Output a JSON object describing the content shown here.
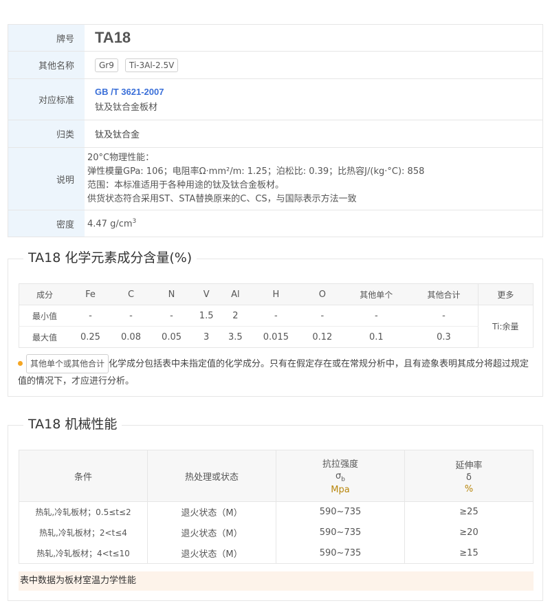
{
  "info": {
    "grade_label": "牌号",
    "grade": "TA18",
    "alias_label": "其他名称",
    "aliases": [
      "Gr9",
      "Ti-3Al-2.5V"
    ],
    "standard_label": "对应标准",
    "standard_code": "GB /T 3621-2007",
    "standard_name": "钛及钛合金板材",
    "category_label": "归类",
    "category": "钛及钛合金",
    "desc_label": "说明",
    "desc_lines": [
      "20°C物理性能：",
      "弹性模量GPa: 106；电阻率Ω·mm²/m: 1.25；泊松比: 0.39；比热容J/(kg·°C): 858",
      "范围：本标准适用于各种用途的钛及钛合金板材。",
      "供货状态符合采用ST、STA替换原来的C、CS，与国际表示方法一致"
    ],
    "density_label": "密度",
    "density": "4.47 g/cm",
    "density_exp": "3"
  },
  "chem": {
    "title": "TA18 化学元素成分含量(%)",
    "headers": [
      "成分",
      "Fe",
      "C",
      "N",
      "V",
      "Al",
      "H",
      "O",
      "其他单个",
      "其他合计",
      "更多"
    ],
    "rows": [
      {
        "label": "最小值",
        "values": [
          "-",
          "-",
          "-",
          "1.5",
          "2",
          "-",
          "-",
          "-",
          "-"
        ]
      },
      {
        "label": "最大值",
        "values": [
          "0.25",
          "0.08",
          "0.05",
          "3",
          "3.5",
          "0.015",
          "0.12",
          "0.1",
          "0.3"
        ]
      }
    ],
    "more_value": "Ti:余量",
    "note_tag": "其他单个或其他合计",
    "note_text": "化学成分包括表中未指定值的化学成分。只有在假定存在或在常规分析中，且有迹象表明其成分将超过规定值的情况下，才应进行分析。"
  },
  "mech": {
    "title": "TA18 机械性能",
    "headers": {
      "condition": "条件",
      "treatment": "热处理或状态",
      "tensile": "抗拉强度",
      "tensile_symbol": "σ",
      "tensile_sub": "b",
      "tensile_unit": "Mpa",
      "elong": "延伸率",
      "elong_symbol": "δ",
      "elong_unit": "%"
    },
    "rows": [
      {
        "condition": "热轧,冷轧板材；0.5≤t≤2",
        "treatment": "退火状态（M）",
        "tensile": "590~735",
        "elong": "≥25"
      },
      {
        "condition": "热轧,冷轧板材；2<t≤4",
        "treatment": "退火状态（M）",
        "tensile": "590~735",
        "elong": "≥20"
      },
      {
        "condition": "热轧,冷轧板材；4<t≤10",
        "treatment": "退火状态（M）",
        "tensile": "590~735",
        "elong": "≥15"
      }
    ],
    "footnote": "表中数据为板材室温力学性能"
  },
  "colors": {
    "label_bg": "#edf5fc",
    "link": "#3a6fd8",
    "bullet": "#f5a623",
    "unit": "#b8860b",
    "footnote_bg": "#fdf3ea"
  }
}
